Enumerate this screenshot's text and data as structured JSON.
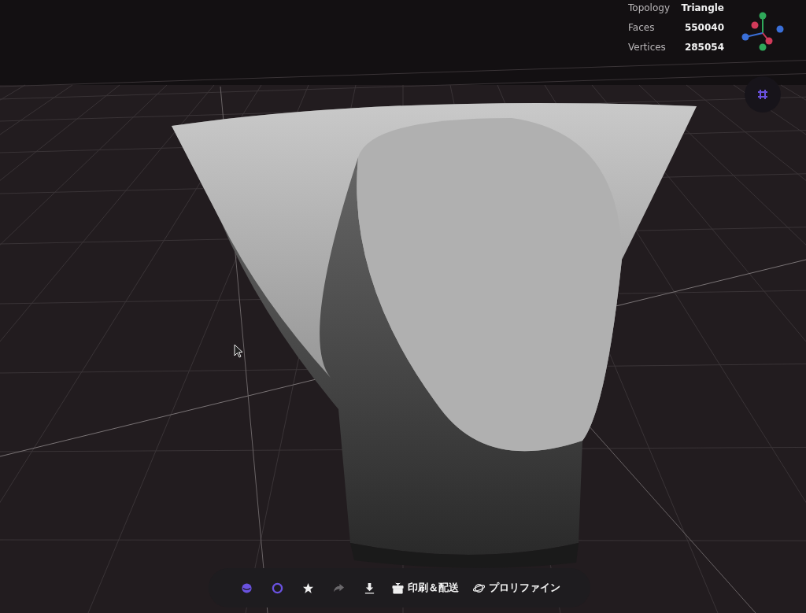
{
  "stats": [
    {
      "label": "Topology",
      "value": "Triangle"
    },
    {
      "label": "Faces",
      "value": "550040"
    },
    {
      "label": "Vertices",
      "value": "285054"
    }
  ],
  "grid_toggle": {
    "on": true
  },
  "toolbar": [
    {
      "kind": "icon",
      "active": true,
      "disabled": false
    },
    {
      "kind": "icon",
      "active": true,
      "disabled": false
    },
    {
      "kind": "icon",
      "active": false,
      "disabled": false
    },
    {
      "kind": "icon",
      "active": false,
      "disabled": true
    },
    {
      "kind": "icon",
      "active": false,
      "disabled": false
    },
    {
      "kind": "labeled",
      "label": "印刷＆配送",
      "active": false,
      "disabled": false
    },
    {
      "kind": "labeled",
      "label": "プロリファイン",
      "active": false,
      "disabled": false
    }
  ]
}
